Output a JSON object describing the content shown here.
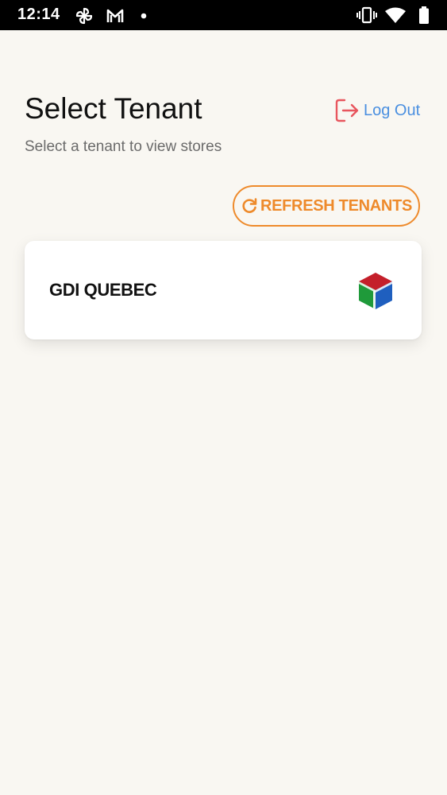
{
  "status_bar": {
    "time": "12:14",
    "left_icons": [
      "pinwheel-icon",
      "gmail-icon",
      "notification-dot-icon"
    ],
    "right_icons": [
      "vibrate-icon",
      "wifi-icon",
      "battery-icon"
    ]
  },
  "header": {
    "title": "Select Tenant",
    "subtitle": "Select a tenant to view stores",
    "logout_label": "Log Out",
    "logout_icon": "logout-icon"
  },
  "actions": {
    "refresh_label": "REFRESH TENANTS",
    "refresh_icon": "refresh-icon"
  },
  "tenants": [
    {
      "name": "GDI QUEBEC",
      "logo_icon": "cube-logo-icon"
    }
  ],
  "colors": {
    "background": "#f9f7f2",
    "accent_orange": "#ee8a2b",
    "link_blue": "#4a8fe0",
    "logout_icon_red": "#e8565e",
    "cube_red": "#c41f2a",
    "cube_green": "#1f9a3a",
    "cube_blue": "#1f5fbf"
  }
}
